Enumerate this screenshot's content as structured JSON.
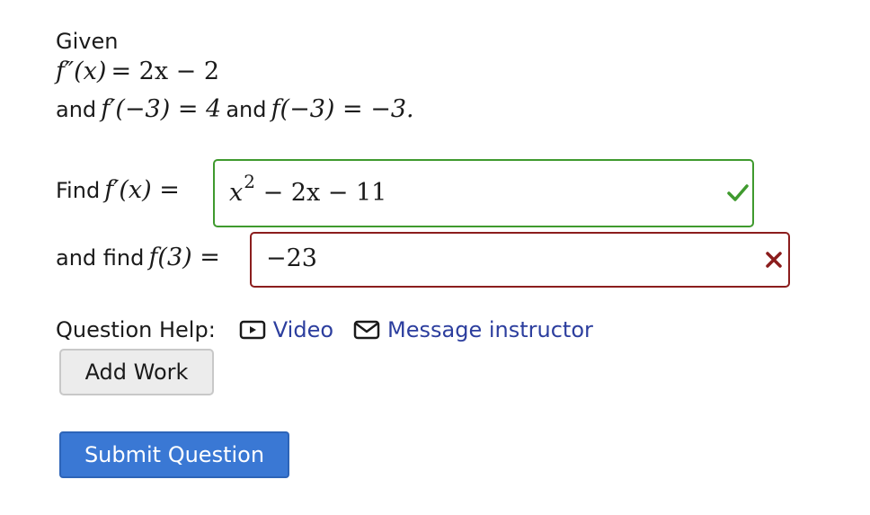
{
  "problem": {
    "given_label": "Given",
    "fpp_lhs": "f″(x)",
    "fpp_rhs": "= 2x − 2",
    "cond_and1": "and",
    "cond_fp": "f′(−3) = 4",
    "cond_and2": "and",
    "cond_f": "f(−3) = −3."
  },
  "answers": {
    "find_fprime_word": "Find",
    "fprime_lhs": "f′(x) =",
    "fprime_value_base": "x",
    "fprime_value_exp": "2",
    "fprime_value_rest": "− 2x − 11",
    "fprime_status": "correct",
    "find_f3_word": "and find",
    "f3_lhs": "f(3) =",
    "f3_value": "−23",
    "f3_status": "incorrect"
  },
  "help": {
    "label": "Question Help:",
    "video_label": "Video",
    "message_label": "Message instructor",
    "video_icon": "play-video-icon",
    "message_icon": "envelope-icon"
  },
  "buttons": {
    "add_work": "Add Work",
    "submit": "Submit Question"
  },
  "colors": {
    "correct": "#3f9a2e",
    "incorrect": "#8b1d1d",
    "link": "#2c3e9e",
    "submit_bg": "#3a78d4"
  }
}
